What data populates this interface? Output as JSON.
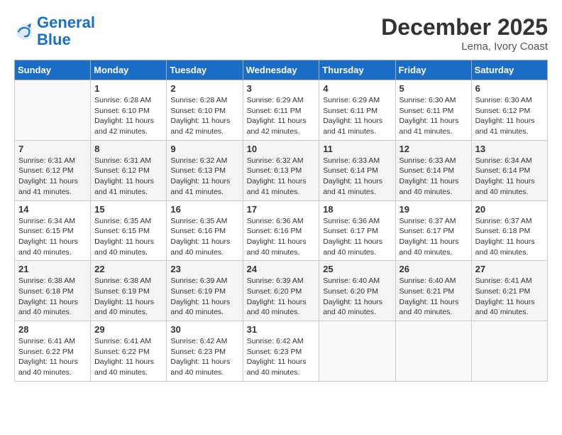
{
  "header": {
    "logo_line1": "General",
    "logo_line2": "Blue",
    "month": "December 2025",
    "location": "Lema, Ivory Coast"
  },
  "weekdays": [
    "Sunday",
    "Monday",
    "Tuesday",
    "Wednesday",
    "Thursday",
    "Friday",
    "Saturday"
  ],
  "weeks": [
    [
      {
        "day": "",
        "sunrise": "",
        "sunset": "",
        "daylight": ""
      },
      {
        "day": "1",
        "sunrise": "6:28 AM",
        "sunset": "6:10 PM",
        "daylight": "11 hours and 42 minutes."
      },
      {
        "day": "2",
        "sunrise": "6:28 AM",
        "sunset": "6:10 PM",
        "daylight": "11 hours and 42 minutes."
      },
      {
        "day": "3",
        "sunrise": "6:29 AM",
        "sunset": "6:11 PM",
        "daylight": "11 hours and 42 minutes."
      },
      {
        "day": "4",
        "sunrise": "6:29 AM",
        "sunset": "6:11 PM",
        "daylight": "11 hours and 41 minutes."
      },
      {
        "day": "5",
        "sunrise": "6:30 AM",
        "sunset": "6:11 PM",
        "daylight": "11 hours and 41 minutes."
      },
      {
        "day": "6",
        "sunrise": "6:30 AM",
        "sunset": "6:12 PM",
        "daylight": "11 hours and 41 minutes."
      }
    ],
    [
      {
        "day": "7",
        "sunrise": "6:31 AM",
        "sunset": "6:12 PM",
        "daylight": "11 hours and 41 minutes."
      },
      {
        "day": "8",
        "sunrise": "6:31 AM",
        "sunset": "6:12 PM",
        "daylight": "11 hours and 41 minutes."
      },
      {
        "day": "9",
        "sunrise": "6:32 AM",
        "sunset": "6:13 PM",
        "daylight": "11 hours and 41 minutes."
      },
      {
        "day": "10",
        "sunrise": "6:32 AM",
        "sunset": "6:13 PM",
        "daylight": "11 hours and 41 minutes."
      },
      {
        "day": "11",
        "sunrise": "6:33 AM",
        "sunset": "6:14 PM",
        "daylight": "11 hours and 41 minutes."
      },
      {
        "day": "12",
        "sunrise": "6:33 AM",
        "sunset": "6:14 PM",
        "daylight": "11 hours and 40 minutes."
      },
      {
        "day": "13",
        "sunrise": "6:34 AM",
        "sunset": "6:14 PM",
        "daylight": "11 hours and 40 minutes."
      }
    ],
    [
      {
        "day": "14",
        "sunrise": "6:34 AM",
        "sunset": "6:15 PM",
        "daylight": "11 hours and 40 minutes."
      },
      {
        "day": "15",
        "sunrise": "6:35 AM",
        "sunset": "6:15 PM",
        "daylight": "11 hours and 40 minutes."
      },
      {
        "day": "16",
        "sunrise": "6:35 AM",
        "sunset": "6:16 PM",
        "daylight": "11 hours and 40 minutes."
      },
      {
        "day": "17",
        "sunrise": "6:36 AM",
        "sunset": "6:16 PM",
        "daylight": "11 hours and 40 minutes."
      },
      {
        "day": "18",
        "sunrise": "6:36 AM",
        "sunset": "6:17 PM",
        "daylight": "11 hours and 40 minutes."
      },
      {
        "day": "19",
        "sunrise": "6:37 AM",
        "sunset": "6:17 PM",
        "daylight": "11 hours and 40 minutes."
      },
      {
        "day": "20",
        "sunrise": "6:37 AM",
        "sunset": "6:18 PM",
        "daylight": "11 hours and 40 minutes."
      }
    ],
    [
      {
        "day": "21",
        "sunrise": "6:38 AM",
        "sunset": "6:18 PM",
        "daylight": "11 hours and 40 minutes."
      },
      {
        "day": "22",
        "sunrise": "6:38 AM",
        "sunset": "6:19 PM",
        "daylight": "11 hours and 40 minutes."
      },
      {
        "day": "23",
        "sunrise": "6:39 AM",
        "sunset": "6:19 PM",
        "daylight": "11 hours and 40 minutes."
      },
      {
        "day": "24",
        "sunrise": "6:39 AM",
        "sunset": "6:20 PM",
        "daylight": "11 hours and 40 minutes."
      },
      {
        "day": "25",
        "sunrise": "6:40 AM",
        "sunset": "6:20 PM",
        "daylight": "11 hours and 40 minutes."
      },
      {
        "day": "26",
        "sunrise": "6:40 AM",
        "sunset": "6:21 PM",
        "daylight": "11 hours and 40 minutes."
      },
      {
        "day": "27",
        "sunrise": "6:41 AM",
        "sunset": "6:21 PM",
        "daylight": "11 hours and 40 minutes."
      }
    ],
    [
      {
        "day": "28",
        "sunrise": "6:41 AM",
        "sunset": "6:22 PM",
        "daylight": "11 hours and 40 minutes."
      },
      {
        "day": "29",
        "sunrise": "6:41 AM",
        "sunset": "6:22 PM",
        "daylight": "11 hours and 40 minutes."
      },
      {
        "day": "30",
        "sunrise": "6:42 AM",
        "sunset": "6:23 PM",
        "daylight": "11 hours and 40 minutes."
      },
      {
        "day": "31",
        "sunrise": "6:42 AM",
        "sunset": "6:23 PM",
        "daylight": "11 hours and 40 minutes."
      },
      {
        "day": "",
        "sunrise": "",
        "sunset": "",
        "daylight": ""
      },
      {
        "day": "",
        "sunrise": "",
        "sunset": "",
        "daylight": ""
      },
      {
        "day": "",
        "sunrise": "",
        "sunset": "",
        "daylight": ""
      }
    ]
  ]
}
